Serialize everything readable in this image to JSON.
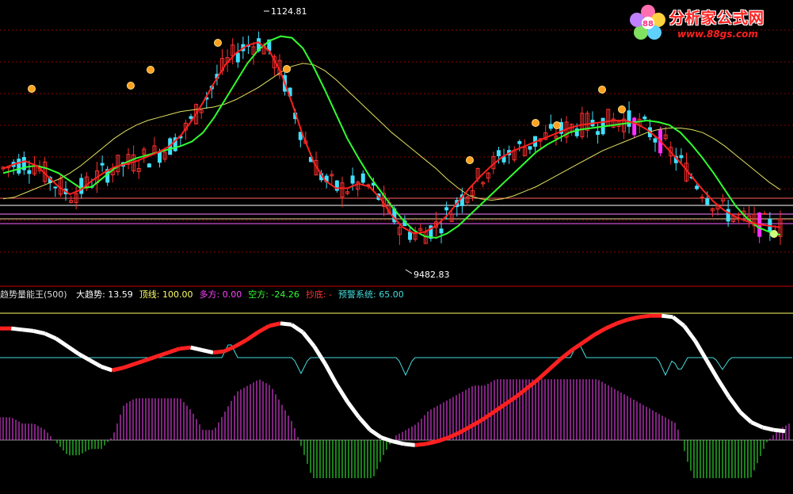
{
  "logo": {
    "name": "分析家公式网",
    "url_text": "www.88gs.com"
  },
  "price_panel": {
    "high_label": "1124.81",
    "low_label": "9482.83"
  },
  "indicator_header": {
    "name": "趋势量能王(500)",
    "items": [
      {
        "label": "大趋势:",
        "value": "13.59",
        "color": "#ffffff"
      },
      {
        "label": "顶线:",
        "value": "100.00",
        "color": "#ffff66"
      },
      {
        "label": "多方:",
        "value": "0.00",
        "color": "#ff44ff"
      },
      {
        "label": "空方:",
        "value": "-24.26",
        "color": "#33ff33"
      },
      {
        "label": "抄底:",
        "value": "-",
        "color": "#ff3333"
      },
      {
        "label": "预警系统:",
        "value": "65.00",
        "color": "#44dddd"
      }
    ]
  },
  "colors": {
    "up_candle": "#ff3030",
    "down_candle": "#40e0ff",
    "big_down": "#ff30ff",
    "ma_fast": "#ff2020",
    "ma_mid": "#30ff30",
    "ma_slow": "#e0e060",
    "grid": "#8b0000",
    "top_line": "#ffff66",
    "warn_line": "#44dddd",
    "bull_bars": "#ff44ff",
    "bear_bars": "#33ff33"
  },
  "chart_data": [
    {
      "type": "candlestick",
      "title": "",
      "x": [],
      "ma_slow_y": [
        9980,
        9990,
        10020,
        10050,
        10080,
        10110,
        10150,
        10200,
        10260,
        10320,
        10380,
        10430,
        10470,
        10500,
        10520,
        10540,
        10560,
        10570,
        10580,
        10590,
        10610,
        10640,
        10680,
        10720,
        10770,
        10820,
        10860,
        10880,
        10870,
        10830,
        10770,
        10700,
        10630,
        10560,
        10490,
        10420,
        10360,
        10300,
        10240,
        10180,
        10110,
        10050,
        10000,
        9980,
        9970,
        9980,
        10000,
        10030,
        10060,
        10100,
        10140,
        10180,
        10220,
        10260,
        10300,
        10330,
        10360,
        10390,
        10420,
        10440,
        10450,
        10450,
        10440,
        10420,
        10380,
        10330,
        10270,
        10210,
        10150,
        10090,
        10040
      ],
      "ma_mid_y": [
        10150,
        10170,
        10190,
        10200,
        10180,
        10150,
        10100,
        10050,
        10060,
        10120,
        10180,
        10220,
        10250,
        10270,
        10290,
        10310,
        10330,
        10360,
        10420,
        10520,
        10640,
        10760,
        10880,
        10970,
        11030,
        11060,
        11050,
        10980,
        10850,
        10700,
        10540,
        10380,
        10250,
        10130,
        10030,
        9930,
        9840,
        9770,
        9730,
        9720,
        9750,
        9800,
        9870,
        9940,
        10010,
        10080,
        10150,
        10220,
        10290,
        10340,
        10380,
        10420,
        10440,
        10450,
        10460,
        10470,
        10480,
        10490,
        10500,
        10490,
        10470,
        10420,
        10340,
        10250,
        10150,
        10040,
        9930,
        9850,
        9790,
        9760,
        9740
      ],
      "ma_fast_y": [
        10180,
        10210,
        10230,
        10200,
        10130,
        10060,
        10010,
        10040,
        10100,
        10150,
        10190,
        10210,
        10230,
        10260,
        10290,
        10330,
        10400,
        10500,
        10620,
        10750,
        10870,
        10950,
        11000,
        11020,
        10960,
        10820,
        10620,
        10400,
        10220,
        10100,
        10050,
        10050,
        10080,
        10060,
        9980,
        9870,
        9790,
        9750,
        9760,
        9800,
        9870,
        9960,
        10050,
        10130,
        10200,
        10260,
        10300,
        10330,
        10360,
        10390,
        10420,
        10450,
        10470,
        10480,
        10490,
        10500,
        10500,
        10480,
        10440,
        10380,
        10300,
        10220,
        10130,
        10040,
        9960,
        9900,
        9860,
        9830,
        9810,
        9800,
        9790
      ],
      "price_low_label": "9482.83",
      "price_high_label": "1124.81"
    },
    {
      "type": "bar",
      "title": "趋势量能王(500)",
      "top_line": 100.0,
      "warn_line": 65.0,
      "trend_y": [
        88,
        88,
        87,
        86,
        84,
        80,
        74,
        68,
        63,
        58,
        55,
        57,
        60,
        63,
        66,
        69,
        72,
        73,
        71,
        69,
        70,
        74,
        79,
        85,
        90,
        92,
        91,
        85,
        74,
        60,
        44,
        30,
        18,
        8,
        2,
        -1,
        -3,
        -4,
        -3,
        -1,
        2,
        6,
        11,
        16,
        22,
        28,
        34,
        41,
        48,
        56,
        64,
        71,
        77,
        83,
        88,
        92,
        95,
        97,
        98,
        98,
        97,
        90,
        78,
        63,
        48,
        34,
        22,
        14,
        10,
        8,
        7
      ]
    }
  ]
}
